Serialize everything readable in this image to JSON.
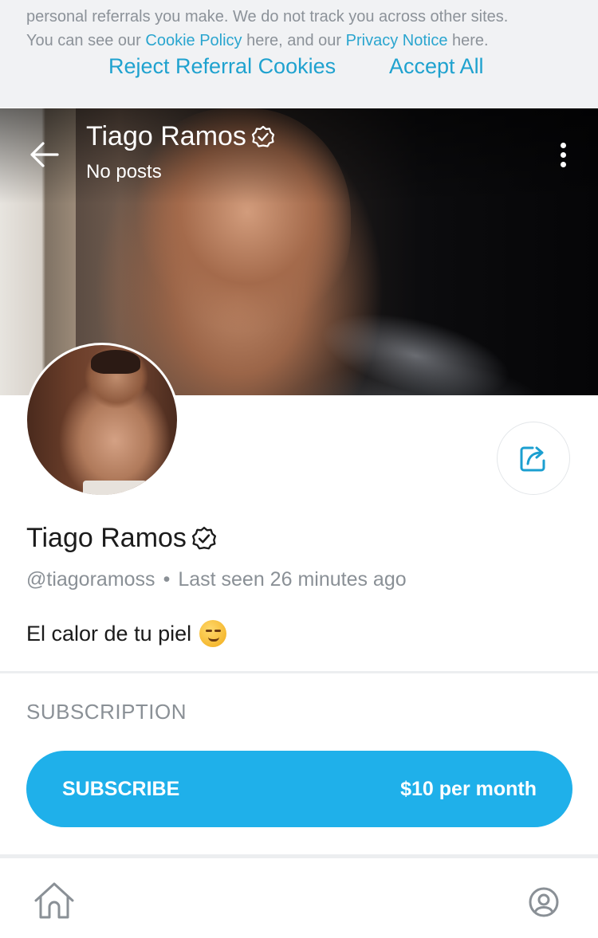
{
  "cookie_banner": {
    "line1": "personal referrals you make. We do not track you across other sites.",
    "line2_prefix": "You can see our ",
    "cookie_policy_link": "Cookie Policy",
    "line2_middle": " here, and our ",
    "privacy_notice_link": "Privacy Notice",
    "line2_suffix": " here.",
    "reject_label": "Reject Referral Cookies",
    "accept_label": "Accept All"
  },
  "header": {
    "name": "Tiago Ramos",
    "posts": "No posts"
  },
  "profile": {
    "name": "Tiago Ramos",
    "handle": "@tiagoramoss",
    "separator": "•",
    "last_seen": "Last seen 26 minutes ago",
    "bio": "El calor de tu piel"
  },
  "subscription": {
    "heading": "SUBSCRIPTION",
    "button_label": "SUBSCRIBE",
    "price": "$10 per month"
  },
  "colors": {
    "accent": "#1fb0ea",
    "link": "#2aa5cf",
    "muted_text": "#8a9096"
  },
  "icons": {
    "back": "arrow-left-icon",
    "more": "more-vertical-icon",
    "verified": "verified-badge-icon",
    "share": "share-icon",
    "home": "home-icon",
    "profile": "user-circle-icon",
    "emoji": "smirk-emoji-icon"
  }
}
